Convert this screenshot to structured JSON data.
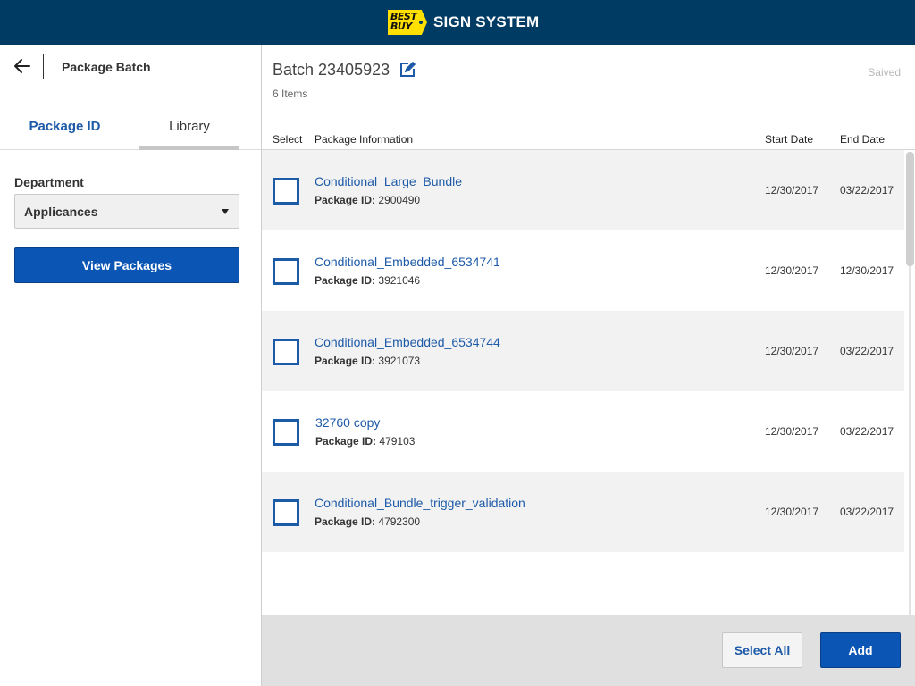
{
  "header": {
    "logo_text_line1": "BEST",
    "logo_text_line2": "BUY",
    "title": "SIGN SYSTEM",
    "bg_color": "#003b64",
    "logo_color": "#ffe000"
  },
  "left_panel": {
    "back_icon": "arrow-left-icon",
    "title": "Package Batch",
    "tabs": [
      {
        "label": "Package ID",
        "active": true
      },
      {
        "label": "Library",
        "active": false
      }
    ],
    "department_label": "Department",
    "department_value": "Applicances",
    "view_button": "View Packages"
  },
  "batch": {
    "title": "Batch 23405923",
    "edit_icon": "edit-icon",
    "saved_status": "Saived",
    "item_count": "6 Items"
  },
  "table": {
    "columns": [
      "Select",
      "Package Information",
      "Start Date",
      "End Date"
    ],
    "id_label": "Package ID:",
    "rows": [
      {
        "name": "Conditional_Large_Bundle",
        "id": "2900490",
        "start": "12/30/2017",
        "end": "03/22/2017"
      },
      {
        "name": "Conditional_Embedded_6534741",
        "id": "3921046",
        "start": "12/30/2017",
        "end": "12/30/2017"
      },
      {
        "name": "Conditional_Embedded_6534744",
        "id": "3921073",
        "start": "12/30/2017",
        "end": "03/22/2017"
      },
      {
        "name": "32760 copy",
        "id": "479103",
        "start": "12/30/2017",
        "end": "03/22/2017"
      },
      {
        "name": "Conditional_Bundle_trigger_validation",
        "id": "4792300",
        "start": "12/30/2017",
        "end": "03/22/2017"
      }
    ]
  },
  "footer": {
    "select_all": "Select All",
    "add": "Add"
  },
  "colors": {
    "accent": "#1d5aa8",
    "primary_button": "#0b56b4",
    "row_alt": "#f2f2f2"
  }
}
